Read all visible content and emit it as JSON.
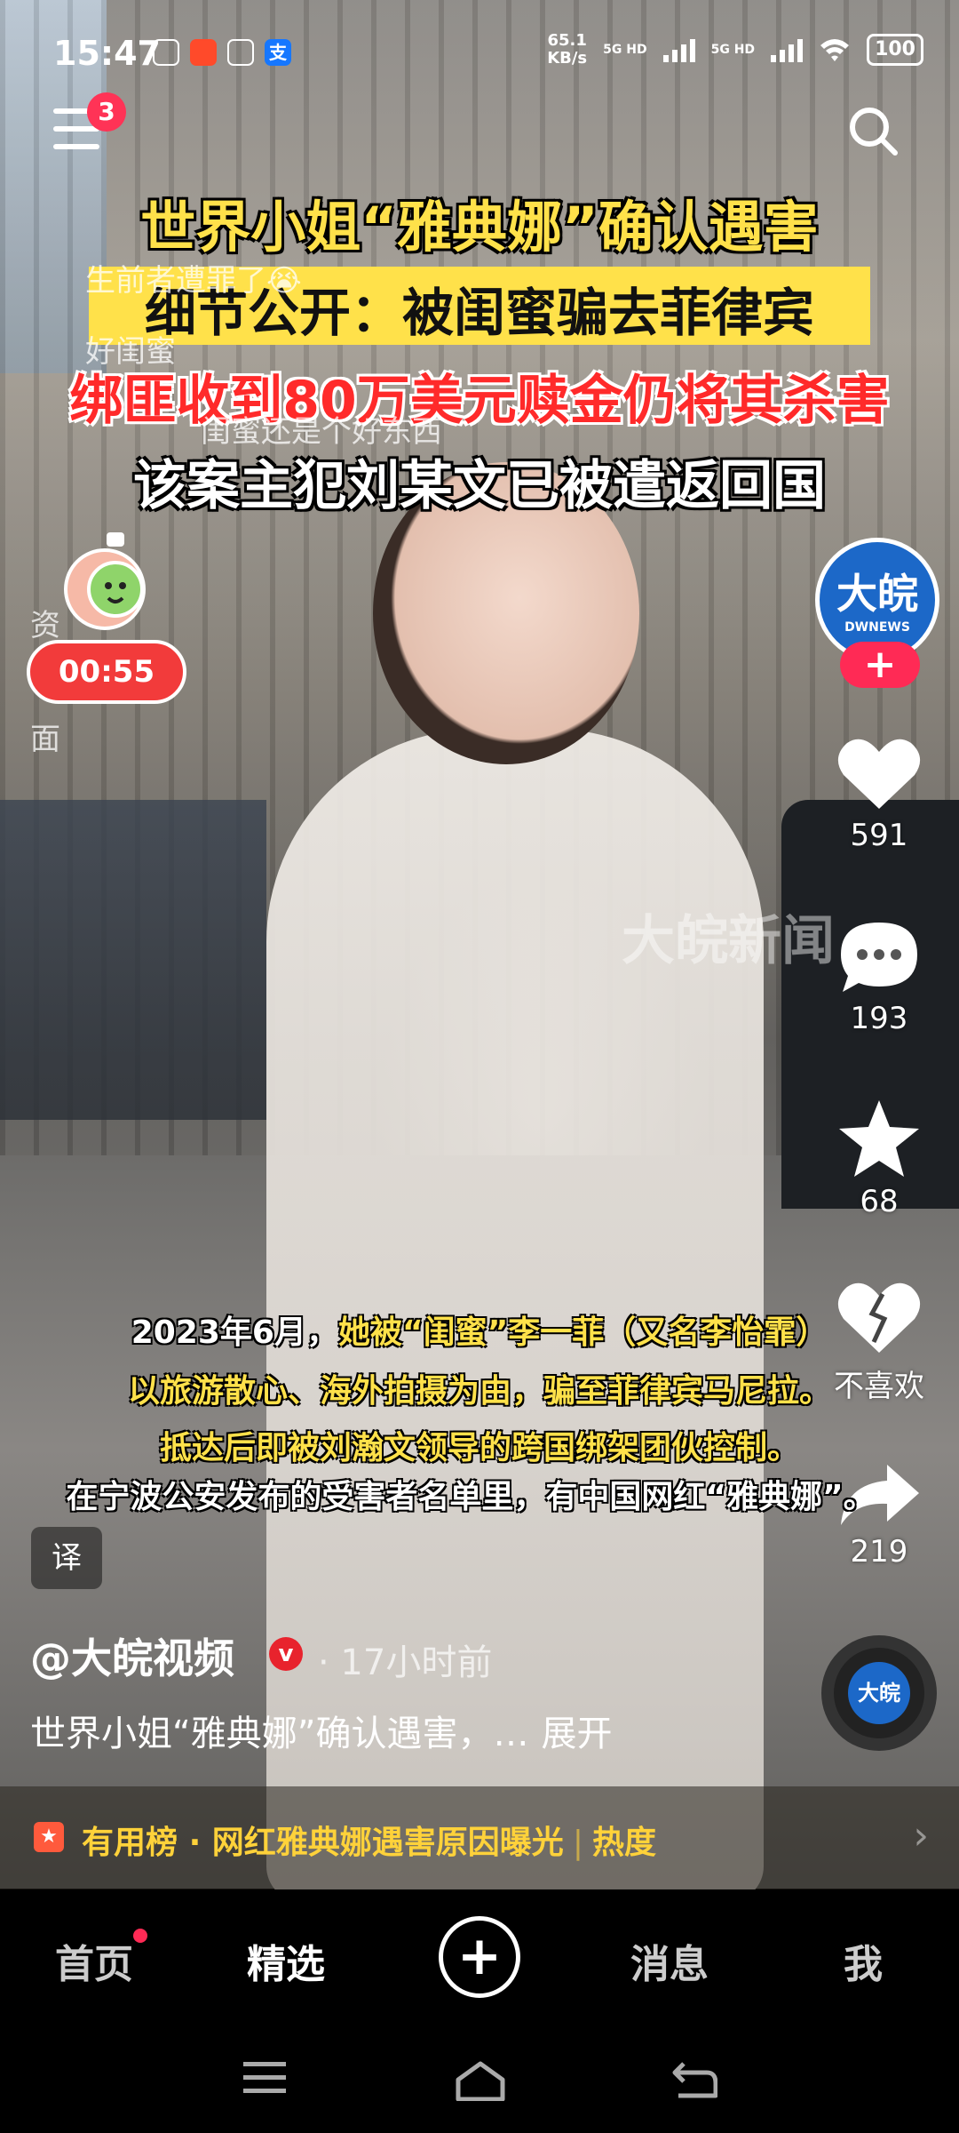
{
  "status_bar": {
    "time": "15:47",
    "app_icons": [
      "支"
    ],
    "speed_value": "65.1",
    "speed_unit": "KB/s",
    "network_1": "5G HD",
    "network_2": "5G HD",
    "battery": "100"
  },
  "top_bar": {
    "menu_badge": "3"
  },
  "headline": {
    "line1": "世界小姐“雅典娜”确认遇害",
    "line2": "细节公开：被闺蜜骗去菲律宾",
    "line3": "绑匪收到80万美元赎金仍将其杀害",
    "line4": "该案主犯刘某文已被遣返回国"
  },
  "danmaku": [
    "生前者遭罪了😭",
    "好闺蜜",
    "闺蜜还是个好东西",
    "资",
    "面"
  ],
  "timer": {
    "label": "00:55"
  },
  "author_avatar": {
    "title": "大皖",
    "subtitle": "DWNEWS"
  },
  "actions": {
    "likes": "591",
    "comments": "193",
    "favorites": "68",
    "dislike_label": "不喜欢",
    "shares": "219"
  },
  "watermark": "大皖新闻",
  "subtitles": {
    "line1_prefix": "2023年6月，",
    "line1_rest": "她被“闺蜜”李一菲（又名李怡霏）",
    "line2": "以旅游散心、海外拍摄为由，骗至菲律宾马尼拉。",
    "line3": "抵达后即被刘瀚文领导的跨国绑架团伙控制。",
    "line4": "在宁波公安发布的受害者名单里，有中国网红“雅典娜”。"
  },
  "translate_btn": "译",
  "post": {
    "author": "@大皖视频",
    "verified_mark": "v",
    "time_ago": "· 17小时前",
    "description": "世界小姐“雅典娜”确认遇害，…",
    "expand": "展开"
  },
  "hot_bar": {
    "label": "有用榜",
    "dot": "·",
    "topic": "网红雅典娜遇害原因曝光",
    "separator": "|",
    "heat": "热度"
  },
  "music": {
    "label": "大皖"
  },
  "bottom_nav": {
    "home": "首页",
    "featured": "精选",
    "add": "+",
    "messages": "消息",
    "me": "我"
  },
  "colors": {
    "accent_yellow": "#ffe14a",
    "accent_red": "#ff2a55",
    "brand_blue": "#1c68c8"
  }
}
